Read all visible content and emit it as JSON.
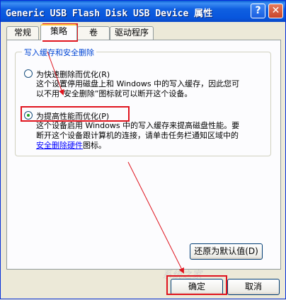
{
  "window": {
    "title": "Generic USB Flash Disk USB Device 属性",
    "help_glyph": "?",
    "close_glyph": "✕"
  },
  "tabs": [
    {
      "label": "常规",
      "active": false
    },
    {
      "label": "策略",
      "active": true
    },
    {
      "label": "卷",
      "active": false
    },
    {
      "label": "驱动程序",
      "active": false
    }
  ],
  "group": {
    "title": "写入缓存和安全删除",
    "option_quick": {
      "label": "为快速删除而优化(R)",
      "desc_line1": "这个设置停用磁盘上和 Windows 中的写入缓存，因此您可",
      "desc_line2": "以不用“安全删除”图标就可以断开这个设备。",
      "checked": false
    },
    "option_perf": {
      "label": "为提高性能而优化(P)",
      "desc_line1": "这个设备启用 Windows 中的写入缓存来提高磁盘性能。要",
      "desc_line2": "断开这个设备跟计算机的连接，请单击任务栏通知区域中的",
      "desc_link": "安全删除硬件",
      "desc_tail": "图标。",
      "checked": true
    }
  },
  "restore_default_label": "还原为默认值(D)",
  "ok_label": "确定",
  "cancel_label": "取消",
  "watermark": "系统之家",
  "colors": {
    "titlebar": "#0A5FD5",
    "annotation": "#E0141E",
    "face": "#ECE9D8"
  }
}
